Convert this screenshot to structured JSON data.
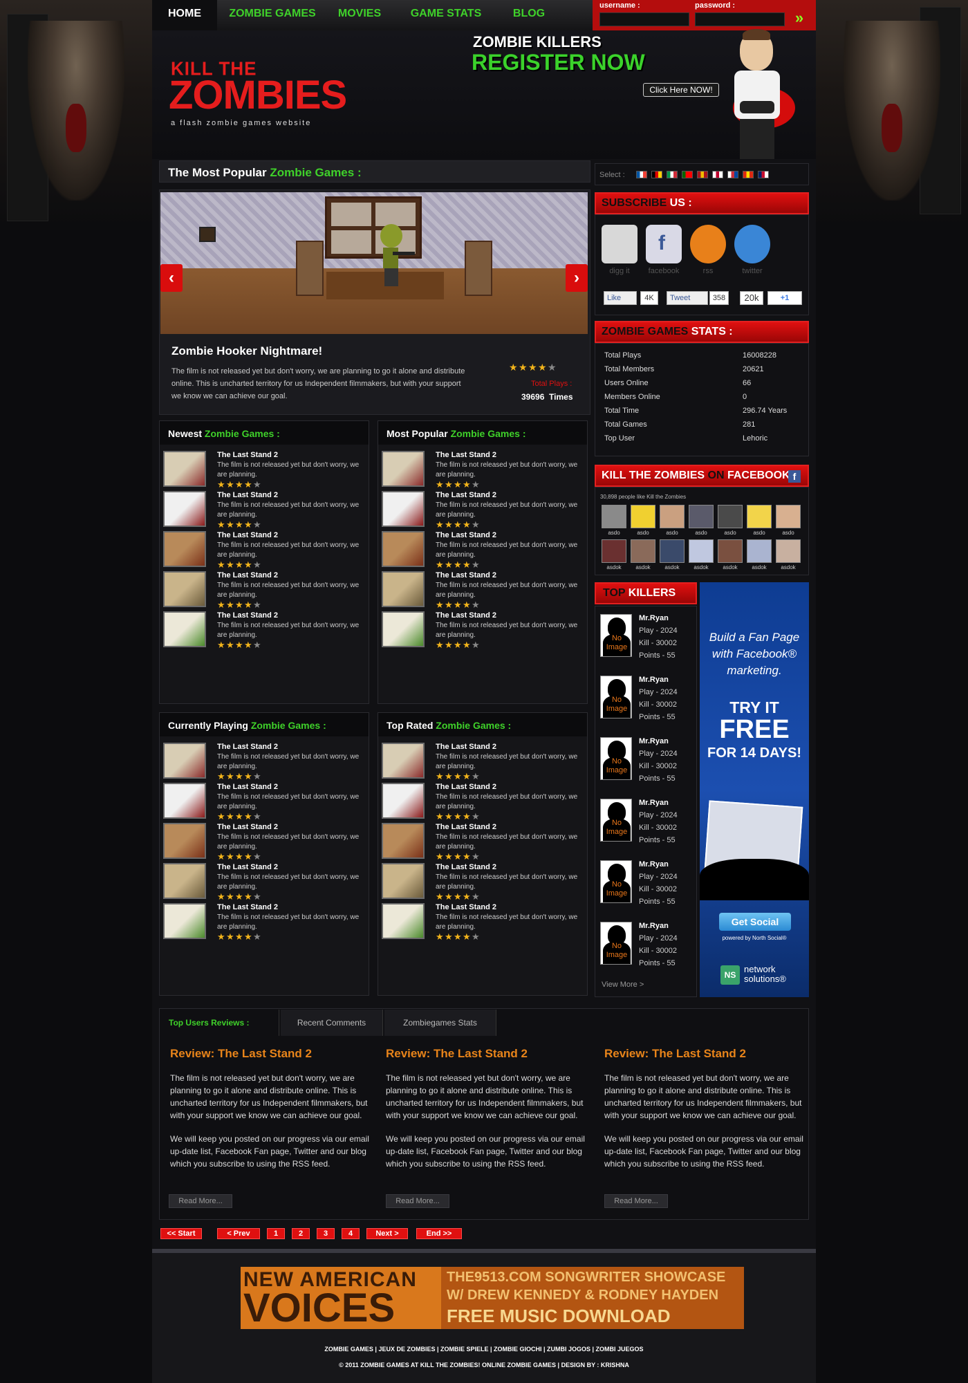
{
  "nav": {
    "items": [
      "HOME",
      "ZOMBIE GAMES",
      "MOVIES",
      "GAME STATS",
      "BLOG"
    ]
  },
  "login": {
    "username_label": "username :",
    "password_label": "password :",
    "username_value": "",
    "password_value": "",
    "submit_icon": "double-arrow-icon"
  },
  "logo": {
    "line1": "KILL THE",
    "line2": "ZOMBIES",
    "tagline": "a flash zombie games website"
  },
  "register": {
    "line1": "ZOMBIE KILLERS",
    "line2": "REGISTER NOW",
    "button": "Click Here NOW!"
  },
  "popular": {
    "title_prefix": "The Most Popular ",
    "title_accent": "Zombie Games :",
    "feature": {
      "title": "Zombie Hooker Nightmare!",
      "description": "The film is not released yet but don't worry, we are planning to go it alone and distribute online. This is uncharted territory for us Independent filmmakers, but with your support we know we can achieve our goal.",
      "rating": 4,
      "plays_label": "Total Plays :",
      "plays_value": "39696",
      "plays_unit": "Times"
    }
  },
  "lists": {
    "newest": {
      "prefix": "Newest ",
      "accent": "Zombie Games :"
    },
    "most_popular": {
      "prefix": "Most Popular ",
      "accent": "Zombie Games :"
    },
    "currently": {
      "prefix": "Currently Playing ",
      "accent": "Zombie Games :"
    },
    "top_rated": {
      "prefix": "Top Rated ",
      "accent": "Zombie Games :"
    },
    "item_title": "The Last Stand 2",
    "item_desc": "The film is not released yet but don't worry, we are planning.",
    "item_rating": 4
  },
  "sidebar": {
    "select_label": "Select :",
    "subscribe": {
      "title_red": "SUBSCRIBE",
      "title_white": " US :",
      "icons": [
        "digg it",
        "facebook",
        "rss",
        "twitter"
      ],
      "like_label": "Like",
      "like_count": "4K",
      "tweet_label": "Tweet",
      "tweet_count": "358",
      "plus_count": "20k",
      "plus_label": "+1"
    },
    "stats": {
      "title_red": "ZOMBIE GAMES",
      "title_white": " STATS :",
      "rows": [
        {
          "label": "Total Plays",
          "value": "16008228"
        },
        {
          "label": "Total Members",
          "value": "20621"
        },
        {
          "label": "Users Online",
          "value": "66"
        },
        {
          "label": "Members Online",
          "value": "0"
        },
        {
          "label": "Total Time",
          "value": "296.74 Years"
        },
        {
          "label": "Total Games",
          "value": "281"
        },
        {
          "label": "Top User",
          "value": "Lehoric"
        }
      ]
    },
    "facebook": {
      "title_white": "KILL THE ZOMBIES",
      "title_red": " ON ",
      "title_white2": "FACEBOOK :",
      "likes_text": "30,898 people like Kill the Zombies",
      "row1_names": [
        "asdo",
        "asdo",
        "asdo",
        "asdo",
        "asdo",
        "asdo",
        "asdo"
      ],
      "row2_names": [
        "asdok",
        "asdok",
        "asdok",
        "asdok",
        "asdok",
        "asdok",
        "asdok"
      ]
    },
    "killers": {
      "title_red": "TOP",
      "title_white": " KILLERS",
      "name": "Mr.Ryan",
      "play": "Play - 2024",
      "kill": "Kill - 30002",
      "points": "Points - 55",
      "noimage": "No Image",
      "view_more": "View More >"
    },
    "ad": {
      "line1": "Build a Fan Page",
      "line2": "with Facebook®",
      "line3": "marketing.",
      "try1": "TRY IT",
      "try2": "FREE",
      "try3": "FOR 14 DAYS!",
      "button": "Get Social",
      "powered": "powered by North Social®",
      "brand1": "network",
      "brand2": "solutions®"
    }
  },
  "tabs": [
    "Top Users Reviews :",
    "Recent Comments",
    "Zombiegames Stats"
  ],
  "reviews": {
    "title": "Review: The Last Stand 2",
    "p1": "The film is not released yet but don't worry, we are planning to go it alone and distribute online. This is uncharted territory for us Independent filmmakers, but with your support we know we can achieve our goal.",
    "p2": "We will keep you posted on our progress via our email up-date list, Facebook Fan page, Twitter and our blog which you subscribe to using the RSS feed.",
    "read_more": "Read More..."
  },
  "pagination": [
    "<< Start",
    "< Prev",
    "1",
    "2",
    "3",
    "4",
    "Next >",
    "End >>"
  ],
  "banner": {
    "left1": "NEW AMERICAN",
    "left2": "VOICES",
    "right1": "THE9513.COM SONGWRITER SHOWCASE",
    "right2": "W/ DREW KENNEDY & RODNEY HAYDEN",
    "right3": "FREE MUSIC DOWNLOAD"
  },
  "footer": {
    "links": "ZOMBIE GAMES | JEUX DE ZOMBIES | ZOMBIE SPIELE | ZOMBIE GIOCHI | ZUMBI JOGOS | ZOMBI JUEGOS",
    "copy": "© 2011 ZOMBIE GAMES AT KILL THE ZOMBIES! ONLINE ZOMBIE GAMES  |  DESIGN BY : KRISHNA"
  },
  "colors": {
    "green": "#3fd12a",
    "red": "#e01010",
    "orange": "#e8841a",
    "bg": "#111114"
  }
}
